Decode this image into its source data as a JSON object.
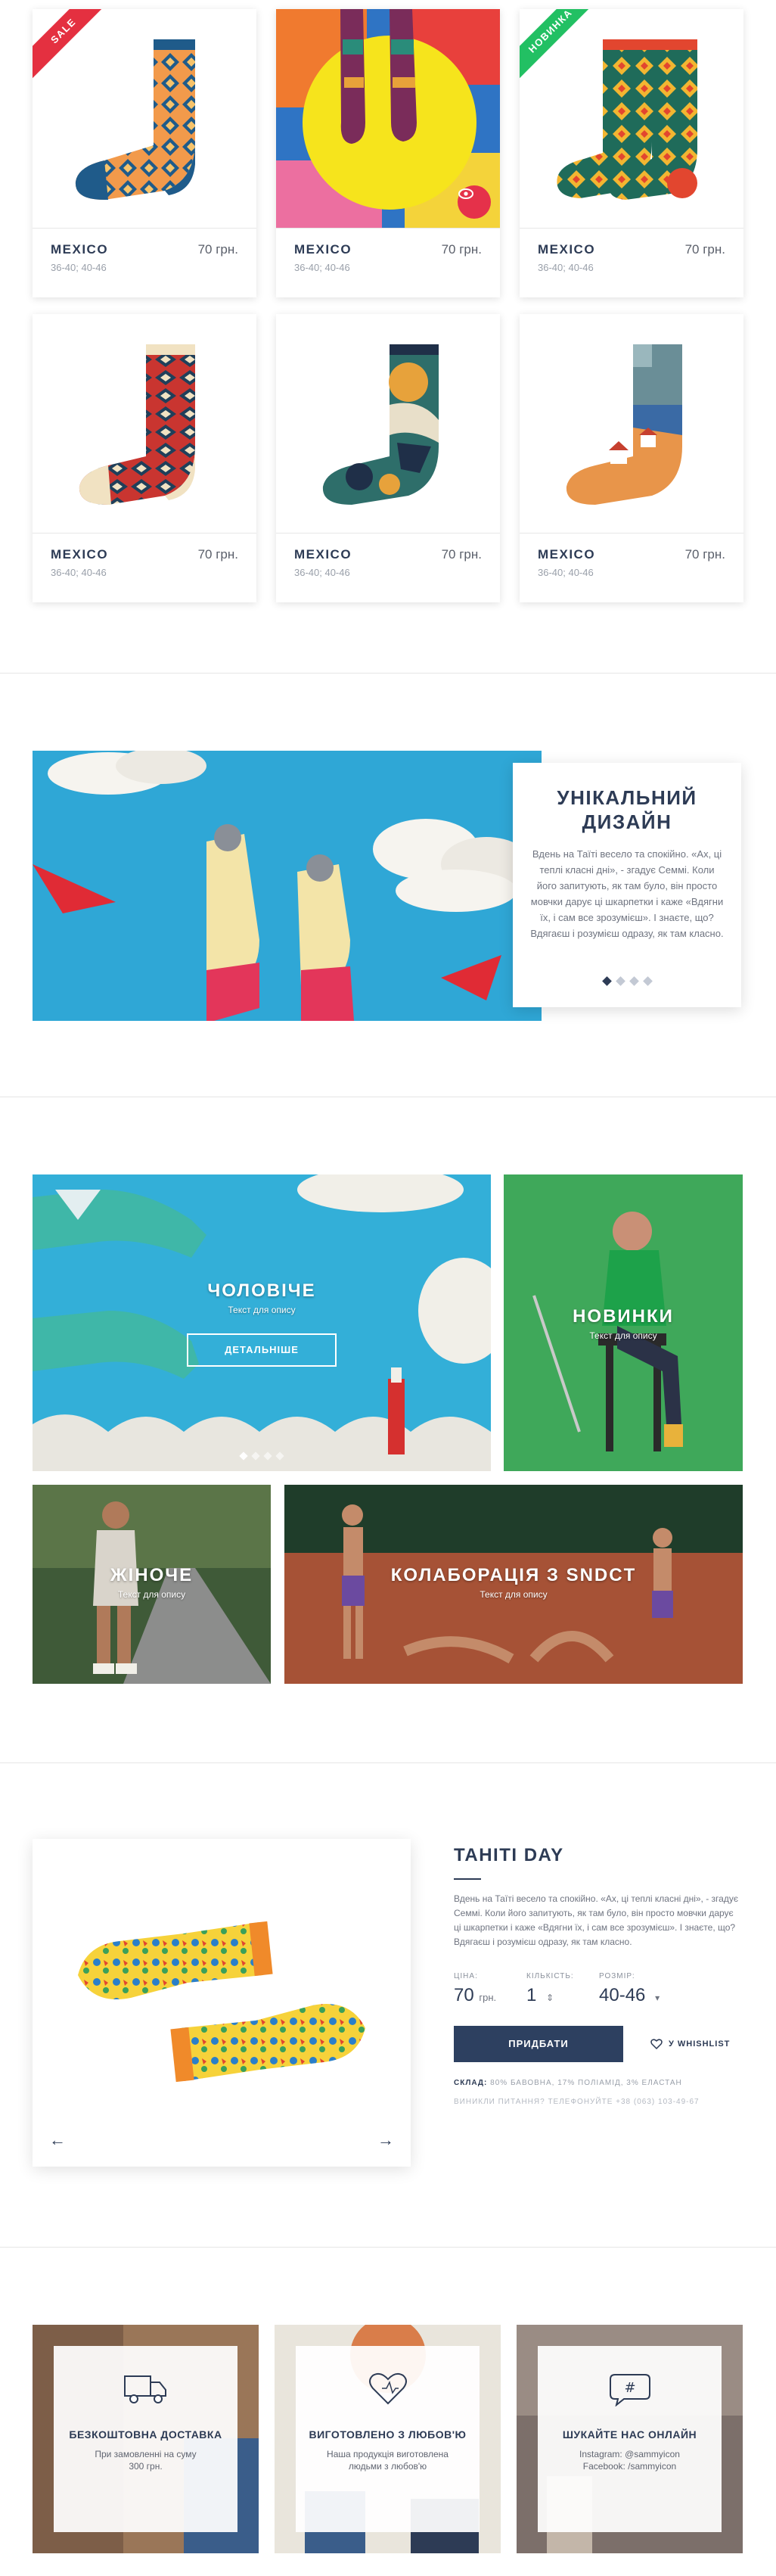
{
  "products": [
    {
      "name": "MEXICO",
      "price": "70 грн.",
      "sizes": "36-40; 40-46",
      "badge": "SALE"
    },
    {
      "name": "MEXICO",
      "price": "70 грн.",
      "sizes": "36-40; 40-46",
      "badge": ""
    },
    {
      "name": "MEXICO",
      "price": "70 грн.",
      "sizes": "36-40; 40-46",
      "badge": "НОВИНКА"
    },
    {
      "name": "MEXICO",
      "price": "70 грн.",
      "sizes": "36-40; 40-46",
      "badge": ""
    },
    {
      "name": "MEXICO",
      "price": "70 грн.",
      "sizes": "36-40; 40-46",
      "badge": ""
    },
    {
      "name": "MEXICO",
      "price": "70 грн.",
      "sizes": "36-40; 40-46",
      "badge": ""
    }
  ],
  "unique": {
    "title_line1": "УНІКАЛЬНИЙ",
    "title_line2": "ДИЗАЙН",
    "text": "Вдень на Таїті весело та спокійно. «Ах, ці теплі класні дні», - згадує Семмі. Коли його запитують, як там було, він просто мовчки дарує ці шкарпетки і каже «Вдягни їх, і сам все зрозумієш». І знаєте, що? Вдягаєш і розумієш одразу, як там класно."
  },
  "categories": {
    "men": {
      "title": "ЧОЛОВІЧЕ",
      "sub": "Текст для опису",
      "button": "ДЕТАЛЬНІШЕ"
    },
    "new": {
      "title": "НОВИНКИ",
      "sub": "Текст для опису"
    },
    "women": {
      "title": "ЖІНОЧЕ",
      "sub": "Текст для опису"
    },
    "collab": {
      "title": "КОЛАБОРАЦІЯ З SNDCT",
      "sub": "Текст для опису"
    }
  },
  "detail": {
    "title": "TAHITI DAY",
    "desc": "Вдень на Таїті весело та спокійно. «Ах, ці теплі класні дні», - згадує Семмі. Коли його запитують, як там було, він просто мовчки дарує ці шкарпетки і каже «Вдягни їх, і сам все зрозумієш». І знаєте, що? Вдягаєш і розумієш одразу, як там класно.",
    "price_label": "ЦІНА:",
    "price_value": "70",
    "price_unit": "грн.",
    "qty_label": "КІЛЬКІСТЬ:",
    "qty_value": "1",
    "size_label": "РОЗМІР:",
    "size_value": "40-46",
    "buy": "ПРИДБАТИ",
    "wishlist": "У WHISHLIST",
    "composition_label": "СКЛАД:",
    "composition": "80% БАВОВНА, 17% ПОЛІАМІД, 3% ЕЛАСТАН",
    "phone": "ВИНИКЛИ ПИТАННЯ? ТЕЛЕФОНУЙТЕ +38 (063) 103-49-67"
  },
  "features": [
    {
      "title": "БЕЗКОШТОВНА ДОСТАВКА",
      "line1": "При замовленні на суму",
      "line2": "300 грн.",
      "icon": "truck-icon"
    },
    {
      "title": "ВИГОТОВЛЕНО З ЛЮБОВ'Ю",
      "line1": "Наша продукція виготовлена",
      "line2": "людьми з любов'ю",
      "icon": "heart-icon"
    },
    {
      "title": "ШУКАЙТЕ НАС ОНЛАЙН",
      "line1": "Instagram: @sammyicon",
      "line2": "Facebook: /sammyicon",
      "icon": "hashtag-chat-icon"
    }
  ],
  "colors": {
    "navy": "#2d3b55",
    "sale": "#e43040",
    "new": "#22c063",
    "accent_red": "#e5314a"
  }
}
